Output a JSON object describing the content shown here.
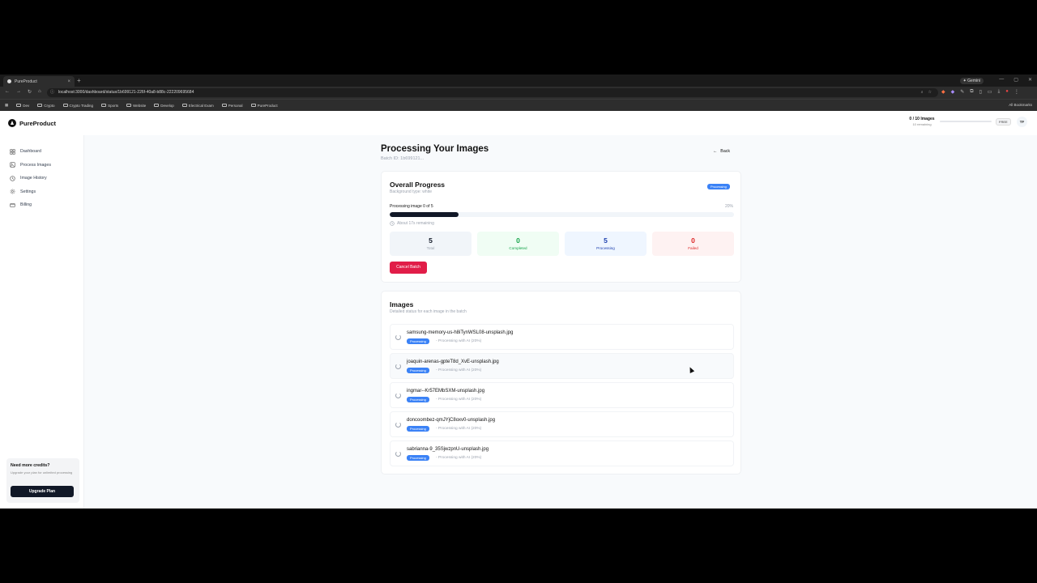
{
  "browser": {
    "tab_title": "PureProduct",
    "tab_close": "×",
    "new_tab": "+",
    "url": "localhost:3000/dashboard/status/1b699121-226f-40a8-b88c-222209695684",
    "gemini_label": "✦ Gemini",
    "all_bookmarks": "All Bookmarks",
    "bookmarks": [
      "Dev",
      "Crypto",
      "Crypto Trading",
      "Sports",
      "Website",
      "Develop",
      "Electrical Exam",
      "Personal",
      "PureProduct"
    ]
  },
  "app": {
    "brand": "PureProduct",
    "credits_title": "0 / 10 Images",
    "credits_sub": "10 remaining",
    "credits_used_fraction": 0.0,
    "plan": "FREE",
    "avatar_initials": "TF"
  },
  "sidebar": {
    "items": [
      {
        "label": "Dashboard",
        "icon": "grid-icon"
      },
      {
        "label": "Process Images",
        "icon": "image-icon"
      },
      {
        "label": "Image History",
        "icon": "history-icon"
      },
      {
        "label": "Settings",
        "icon": "gear-icon"
      },
      {
        "label": "Billing",
        "icon": "card-icon"
      }
    ],
    "upgrade_title": "Need more credits?",
    "upgrade_sub": "Upgrade your plan for unlimited processing",
    "upgrade_button": "Upgrade Plan"
  },
  "page": {
    "title": "Processing Your Images",
    "batch_id": "Batch ID: 1b699121...",
    "back_label": "Back"
  },
  "progress": {
    "title": "Overall Progress",
    "subtitle": "Background type: white",
    "status": "Processing",
    "label": "Processing image 0 of 5",
    "percent_text": "20%",
    "percent": 20,
    "eta": "About 17s remaining",
    "stats": {
      "total": {
        "value": "5",
        "label": "Total",
        "color": "#111827",
        "bg": "#f1f5f9"
      },
      "completed": {
        "value": "0",
        "label": "Completed",
        "color": "#16a34a",
        "bg": "#f0fdf4"
      },
      "processing": {
        "value": "5",
        "label": "Processing",
        "color": "#1e40af",
        "bg": "#eff6ff"
      },
      "failed": {
        "value": "0",
        "label": "Failed",
        "color": "#dc2626",
        "bg": "#fef2f2"
      }
    },
    "cancel_label": "Cancel Batch"
  },
  "images": {
    "title": "Images",
    "subtitle": "Detailed status for each image in the batch",
    "rows": [
      {
        "name": "samsung-memory-us-h8iTynWSL08-unsplash.jpg",
        "badge": "Processing",
        "status": "- Processing with AI (20%)"
      },
      {
        "name": "joaquin-arenas-gpteT8d_XvE-unsplash.jpg",
        "badge": "Processing",
        "status": "- Processing with AI (20%)"
      },
      {
        "name": "ingmar--Kr57EMbSXM-unsplash.jpg",
        "badge": "Processing",
        "status": "- Processing with AI (20%)"
      },
      {
        "name": "doncoombez-qmJYjC8oxv0-unsplash.jpg",
        "badge": "Processing",
        "status": "- Processing with AI (20%)"
      },
      {
        "name": "sabrianna-9_35SjwzpnU-unsplash.jpg",
        "badge": "Processing",
        "status": "- Processing with AI (20%)"
      }
    ]
  },
  "colors": {
    "accent": "#3b82f6",
    "danger": "#e11d48",
    "dark": "#111827"
  }
}
